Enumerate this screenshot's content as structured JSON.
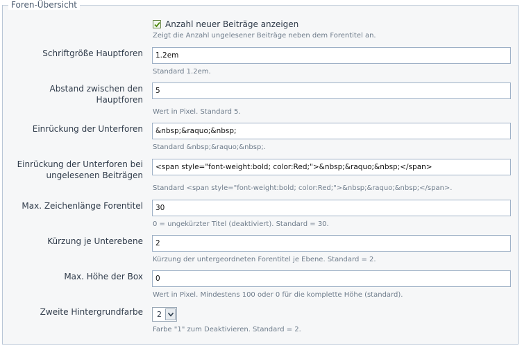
{
  "fieldset": {
    "legend": "Foren-Übersicht"
  },
  "checkbox": {
    "label": "Anzahl neuer Beiträge anzeigen",
    "checked": true,
    "description": "Zeigt die Anzahl ungelesener Beiträge neben dem Forentitel an."
  },
  "fields": [
    {
      "label": "Schriftgröße Hauptforen",
      "value": "1.2em",
      "description": "Standard 1.2em."
    },
    {
      "label": "Abstand zwischen den Hauptforen",
      "value": "5",
      "description": "Wert in Pixel. Standard 5."
    },
    {
      "label": "Einrückung der Unterforen",
      "value": "&nbsp;&raquo;&nbsp;",
      "description": "Standard &nbsp;&raquo;&nbsp;."
    },
    {
      "label": "Einrückung der Unterforen bei ungelesenen Beiträgen",
      "value": "<span style=\"font-weight:bold; color:Red;\">&nbsp;&raquo;&nbsp;</span>",
      "description": "Standard <span style=\"font-weight:bold; color:Red;\">&nbsp;&raquo;&nbsp;</span>."
    },
    {
      "label": "Max. Zeichenlänge Forentitel",
      "value": "30",
      "description": "0 = ungekürzter Titel (deaktiviert). Standard = 30."
    },
    {
      "label": "Kürzung je Unterebene",
      "value": "2",
      "description": "Kürzung der untergeordneten Forentitel je Ebene. Standard = 2."
    },
    {
      "label": "Max. Höhe der Box",
      "value": "0",
      "description": "Wert in Pixel. Mindestens 100 oder 0 für die komplette Höhe (standard)."
    }
  ],
  "select_field": {
    "label": "Zweite Hintergrundfarbe",
    "selected": "2",
    "description": "Farbe \"1\" zum Deaktivieren. Standard = 2."
  },
  "colors": {
    "border": "#b9c6d6",
    "background": "#f6f7f8",
    "description": "#6e7c8b",
    "check": "#4f8a10"
  }
}
